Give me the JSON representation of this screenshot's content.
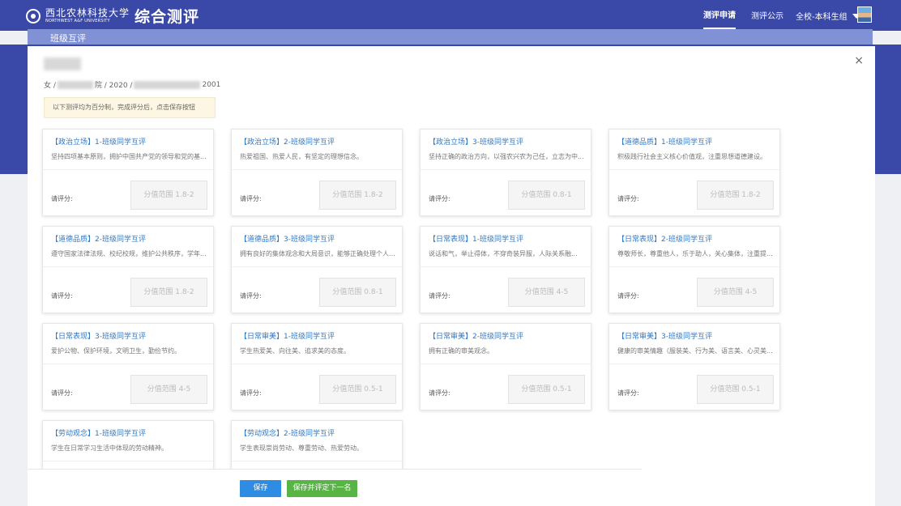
{
  "header": {
    "university_cn": "西北农林科技大学",
    "university_en": "NORTHWEST A&F UNIVERSITY",
    "system_title": "综合测评",
    "nav": {
      "apply": "测评申请",
      "public": "测评公示"
    },
    "role": "全校-本科生组",
    "sub_title": "班级互评"
  },
  "student": {
    "gender": "女 /",
    "college_suffix": "院 / 2020 /",
    "id_suffix": "2001"
  },
  "notice": "以下测评均为百分制，完成评分后，点击保存按钮",
  "cards": [
    {
      "title": "【政治立场】1-班级同学互评",
      "desc": "坚持四项基本原则，拥护中国共产党的领导和党的基...",
      "label": "请评分:",
      "placeholder": "分值范围 1.8-2"
    },
    {
      "title": "【政治立场】2-班级同学互评",
      "desc": "热爱祖国、热爱人民，有坚定的理想信念。",
      "label": "请评分:",
      "placeholder": "分值范围 1.8-2"
    },
    {
      "title": "【政治立场】3-班级同学互评",
      "desc": "坚持正确的政治方向，以强农兴农为己任，立志为中...",
      "label": "请评分:",
      "placeholder": "分值范围 0.8-1"
    },
    {
      "title": "【道德品质】1-班级同学互评",
      "desc": "积极践行社会主义核心价值观，注重思想道德建设。",
      "label": "请评分:",
      "placeholder": "分值范围 1.8-2"
    },
    {
      "title": "【道德品质】2-班级同学互评",
      "desc": "遵守国家法律法规、校纪校规，维护公共秩序，学年...",
      "label": "请评分:",
      "placeholder": "分值范围 1.8-2"
    },
    {
      "title": "【道德品质】3-班级同学互评",
      "desc": "拥有良好的集体观念和大局意识，能够正确处理个人...",
      "label": "请评分:",
      "placeholder": "分值范围 0.8-1"
    },
    {
      "title": "【日常表现】1-班级同学互评",
      "desc": "说话和气，举止得体，不穿奇装异服，人际关系融...",
      "label": "请评分:",
      "placeholder": "分值范围 4-5"
    },
    {
      "title": "【日常表现】2-班级同学互评",
      "desc": "尊敬师长，尊重他人，乐于助人，关心集体，注重提...",
      "label": "请评分:",
      "placeholder": "分值范围 4-5"
    },
    {
      "title": "【日常表现】3-班级同学互评",
      "desc": "爱护公物、保护环境，文明卫生，勤俭节约。",
      "label": "请评分:",
      "placeholder": "分值范围 4-5"
    },
    {
      "title": "【日常审美】1-班级同学互评",
      "desc": "学生热爱美、向往美、追求美的态度。",
      "label": "请评分:",
      "placeholder": "分值范围 0.5-1"
    },
    {
      "title": "【日常审美】2-班级同学互评",
      "desc": "拥有正确的审美观念。",
      "label": "请评分:",
      "placeholder": "分值范围 0.5-1"
    },
    {
      "title": "【日常审美】3-班级同学互评",
      "desc": "健康的审美情趣（服装美、行为美、语言美、心灵美...",
      "label": "请评分:",
      "placeholder": "分值范围 0.5-1"
    },
    {
      "title": "【劳动观念】1-班级同学互评",
      "desc": "学生在日常学习生活中体现的劳动精神。",
      "label": "",
      "placeholder": ""
    },
    {
      "title": "【劳动观念】2-班级同学互评",
      "desc": "学生表现崇尚劳动、尊重劳动、热爱劳动。",
      "label": "",
      "placeholder": ""
    }
  ],
  "buttons": {
    "save": "保存",
    "save_next": "保存并评定下一名"
  },
  "close_label": "×"
}
